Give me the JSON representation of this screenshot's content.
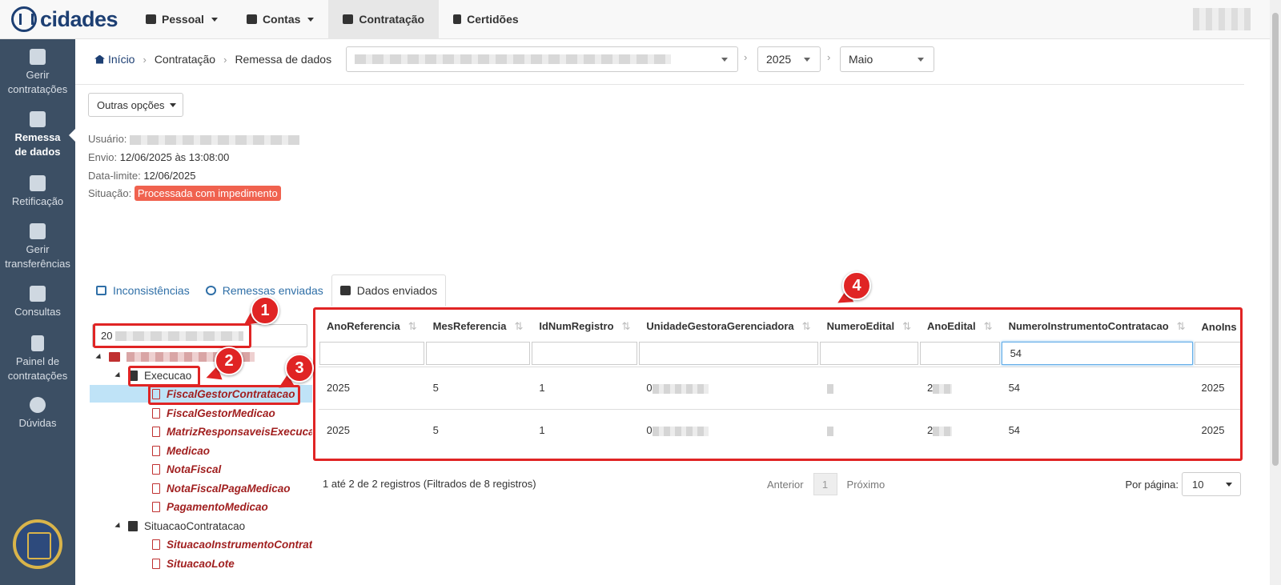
{
  "brand": {
    "name": "cidades"
  },
  "nav": {
    "items": [
      {
        "label": "Pessoal",
        "has_caret": true,
        "icon": "id-card-icon"
      },
      {
        "label": "Contas",
        "has_caret": true,
        "icon": "calendar-icon"
      },
      {
        "label": "Contratação",
        "has_caret": false,
        "icon": "cart-icon",
        "active": true
      },
      {
        "label": "Certidões",
        "has_caret": false,
        "icon": "file-icon"
      }
    ]
  },
  "sidebar": {
    "items": [
      {
        "label": "Gerir contratações",
        "icon": "building-icon"
      },
      {
        "label": "Remessa de dados",
        "icon": "upload-icon",
        "active": true
      },
      {
        "label": "Retificação",
        "icon": "exchange-icon"
      },
      {
        "label": "Gerir transferências",
        "icon": "folder-open-icon"
      },
      {
        "label": "Consultas",
        "icon": "book-icon"
      },
      {
        "label": "Painel de contratações",
        "icon": "file-icon"
      },
      {
        "label": "Dúvidas",
        "icon": "question-circle-icon"
      }
    ]
  },
  "breadcrumb": {
    "home": "Início",
    "level1": "Contratação",
    "level2": "Remessa de dados"
  },
  "filters": {
    "year": "2025",
    "month": "Maio"
  },
  "toolbar": {
    "other_options": "Outras opções"
  },
  "info": {
    "user_label": "Usuário:",
    "send_label": "Envio:",
    "send_value": "12/06/2025 às 13:08:00",
    "deadline_label": "Data-limite:",
    "deadline_value": "12/06/2025",
    "status_label": "Situação:",
    "status_value": "Processada com impedimento",
    "status_color": "#f0624f"
  },
  "tabs": [
    {
      "label": "Inconsistências",
      "icon": "list-icon"
    },
    {
      "label": "Remessas enviadas",
      "icon": "history-icon"
    },
    {
      "label": "Dados enviados",
      "icon": "cart-icon",
      "active": true
    }
  ],
  "tree": {
    "filter_value": "20",
    "group1": "Execucao",
    "group1_items": [
      "FiscalGestorContratacao",
      "FiscalGestorMedicao",
      "MatrizResponsaveisExecucao",
      "Medicao",
      "NotaFiscal",
      "NotaFiscalPagaMedicao",
      "PagamentoMedicao"
    ],
    "group2": "SituacaoContratacao",
    "group2_items": [
      "SituacaoInstrumentoContratacao",
      "SituacaoLote"
    ]
  },
  "table": {
    "columns": [
      "AnoReferencia",
      "MesReferencia",
      "IdNumRegistro",
      "UnidadeGestoraGerenciadora",
      "NumeroEdital",
      "AnoEdital",
      "NumeroInstrumentoContratacao",
      "AnoIns"
    ],
    "filter_value": "54",
    "rows": [
      {
        "ano": "2025",
        "mes": "5",
        "id": "1",
        "ug": "0",
        "num_edital": "",
        "ano_edital": "2",
        "num_instr": "54",
        "ano_ins": "2025"
      },
      {
        "ano": "2025",
        "mes": "5",
        "id": "1",
        "ug": "0",
        "num_edital": "",
        "ano_edital": "2",
        "num_instr": "54",
        "ano_ins": "2025"
      }
    ]
  },
  "footer": {
    "summary": "1 até 2 de 2 registros (Filtrados de 8 registros)",
    "prev": "Anterior",
    "page": "1",
    "next": "Próximo",
    "per_page_label": "Por página:",
    "per_page_value": "10"
  },
  "annotations": [
    "1",
    "2",
    "3",
    "4"
  ],
  "colors": {
    "sidebar": "#3c4f64",
    "brand": "#1d3f73",
    "annotation": "#e02424",
    "link": "#2f6fa7",
    "leaf": "#a12020"
  }
}
